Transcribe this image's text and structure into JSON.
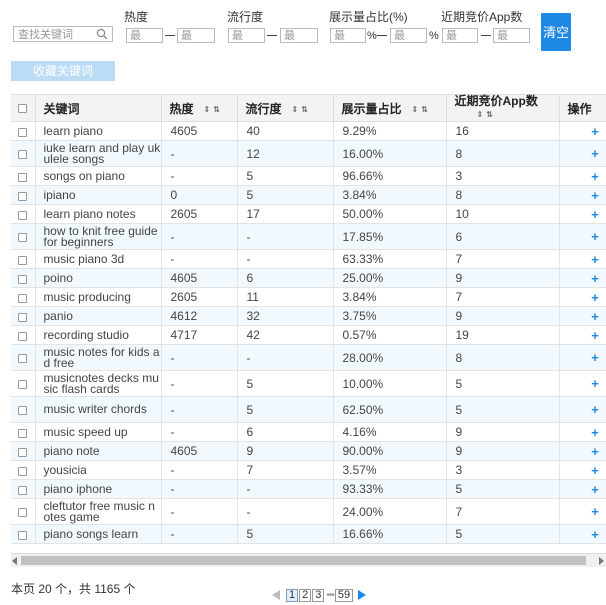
{
  "filters": {
    "search_placeholder": "查找关键词",
    "heat_label": "热度",
    "popularity_label": "流行度",
    "impression_label": "展示量占比(%)",
    "competing_label": "近期竞价App数",
    "min_placeholder": "最",
    "max_placeholder": "最",
    "percent_sign": "%",
    "clear_label": "清空",
    "favorite_label": "收藏关键词"
  },
  "table": {
    "headers": {
      "keyword": "关键词",
      "heat": "热度",
      "popularity": "流行度",
      "impression": "展示量占比",
      "competing": "近期竞价App数",
      "action": "操作"
    },
    "add_symbol": "+",
    "rows": [
      {
        "keyword": "learn piano",
        "heat": "4605",
        "popularity": "40",
        "impression": "9.29%",
        "competing": "16"
      },
      {
        "keyword": "iuke learn and play ukulele songs",
        "heat": "-",
        "popularity": "12",
        "impression": "16.00%",
        "competing": "8"
      },
      {
        "keyword": "songs on piano",
        "heat": "-",
        "popularity": "5",
        "impression": "96.66%",
        "competing": "3"
      },
      {
        "keyword": "ipiano",
        "heat": "0",
        "popularity": "5",
        "impression": "3.84%",
        "competing": "8"
      },
      {
        "keyword": "learn piano notes",
        "heat": "2605",
        "popularity": "17",
        "impression": "50.00%",
        "competing": "10"
      },
      {
        "keyword": "how to knit free guide for beginners",
        "heat": "-",
        "popularity": "-",
        "impression": "17.85%",
        "competing": "6"
      },
      {
        "keyword": "music piano 3d",
        "heat": "-",
        "popularity": "-",
        "impression": "63.33%",
        "competing": "7"
      },
      {
        "keyword": "poino",
        "heat": "4605",
        "popularity": "6",
        "impression": "25.00%",
        "competing": "9"
      },
      {
        "keyword": "music producing",
        "heat": "2605",
        "popularity": "11",
        "impression": "3.84%",
        "competing": "7"
      },
      {
        "keyword": "panio",
        "heat": "4612",
        "popularity": "32",
        "impression": "3.75%",
        "competing": "9"
      },
      {
        "keyword": "recording studio",
        "heat": "4717",
        "popularity": "42",
        "impression": "0.57%",
        "competing": "19"
      },
      {
        "keyword": "music notes for kids ad free",
        "heat": "-",
        "popularity": "-",
        "impression": "28.00%",
        "competing": "8"
      },
      {
        "keyword": "musicnotes decks music flash cards",
        "heat": "-",
        "popularity": "5",
        "impression": "10.00%",
        "competing": "5"
      },
      {
        "keyword": "music writer chords",
        "heat": "-",
        "popularity": "5",
        "impression": "62.50%",
        "competing": "5"
      },
      {
        "keyword": "music speed up",
        "heat": "-",
        "popularity": "6",
        "impression": "4.16%",
        "competing": "9"
      },
      {
        "keyword": "piano note",
        "heat": "4605",
        "popularity": "9",
        "impression": "90.00%",
        "competing": "9"
      },
      {
        "keyword": "yousicia",
        "heat": "-",
        "popularity": "7",
        "impression": "3.57%",
        "competing": "3"
      },
      {
        "keyword": "piano iphone",
        "heat": "-",
        "popularity": "-",
        "impression": "93.33%",
        "competing": "5"
      },
      {
        "keyword": "cleftutor free music notes game",
        "heat": "-",
        "popularity": "-",
        "impression": "24.00%",
        "competing": "7"
      },
      {
        "keyword": "piano songs learn",
        "heat": "-",
        "popularity": "5",
        "impression": "16.66%",
        "competing": "5"
      }
    ]
  },
  "footer": {
    "summary": "本页 20 个，共 1165 个",
    "pages": [
      "1",
      "2",
      "3"
    ],
    "dots": "•••",
    "last_page": "59",
    "current_page": "1"
  },
  "colors": {
    "accent": "#1e88e5",
    "disabled_button": "#bcdcf6",
    "row_alt": "#f2f9fe",
    "header_bg": "#f3f3f3"
  }
}
